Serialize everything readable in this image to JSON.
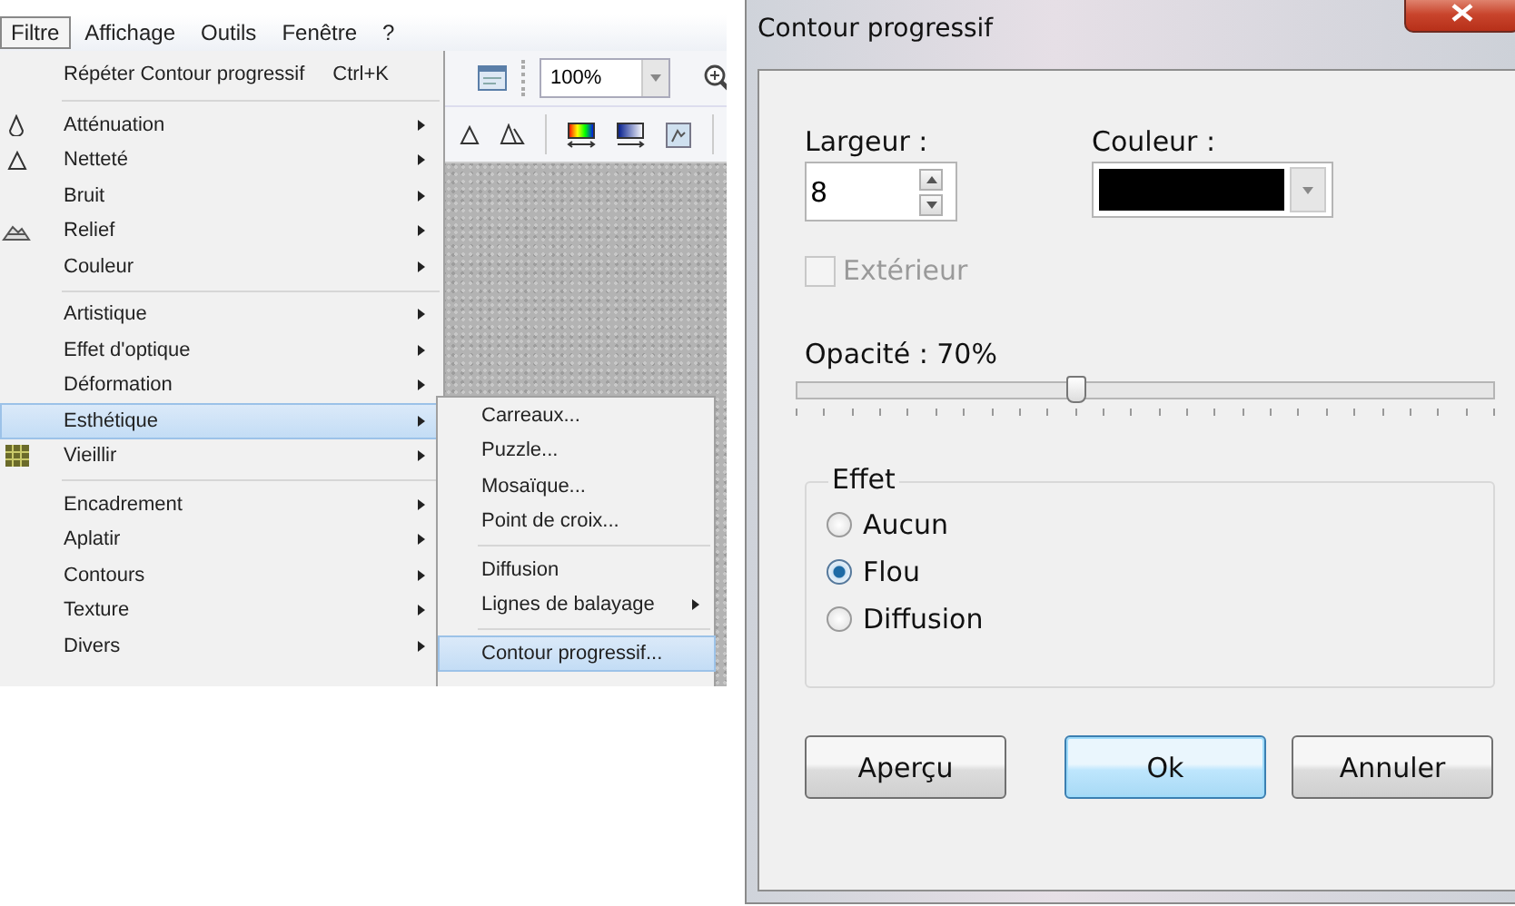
{
  "menubar": [
    {
      "label": "Filtre",
      "selected": true
    },
    {
      "label": "Affichage",
      "selected": false
    },
    {
      "label": "Outils",
      "selected": false
    },
    {
      "label": "Fenêtre",
      "selected": false
    },
    {
      "label": "?",
      "selected": false
    }
  ],
  "toolbar": {
    "zoom": "100%"
  },
  "filter_menu": {
    "groups": [
      [
        {
          "label": "Répéter Contour progressif",
          "shortcut": "Ctrl+K",
          "submenu": false,
          "selected": false,
          "kind": "plain"
        }
      ],
      [
        {
          "label": "Atténuation",
          "submenu": true,
          "selected": false,
          "kind": "drop"
        },
        {
          "label": "Netteté",
          "submenu": true,
          "selected": false,
          "kind": "triangle"
        },
        {
          "label": "Bruit",
          "submenu": true,
          "selected": false,
          "kind": "plain"
        },
        {
          "label": "Relief",
          "submenu": true,
          "selected": false,
          "kind": "mountain"
        },
        {
          "label": "Couleur",
          "submenu": true,
          "selected": false,
          "kind": "plain"
        }
      ],
      [
        {
          "label": "Artistique",
          "submenu": true,
          "selected": false,
          "kind": "plain"
        },
        {
          "label": "Effet d'optique",
          "submenu": true,
          "selected": false,
          "kind": "plain"
        },
        {
          "label": "Déformation",
          "submenu": true,
          "selected": false,
          "kind": "plain"
        },
        {
          "label": "Esthétique",
          "submenu": true,
          "selected": true,
          "kind": "plain"
        },
        {
          "label": "Vieillir",
          "submenu": true,
          "selected": false,
          "kind": "grid"
        }
      ],
      [
        {
          "label": "Encadrement",
          "submenu": true,
          "selected": false,
          "kind": "plain"
        },
        {
          "label": "Aplatir",
          "submenu": true,
          "selected": false,
          "kind": "plain"
        },
        {
          "label": "Contours",
          "submenu": true,
          "selected": false,
          "kind": "plain"
        },
        {
          "label": "Texture",
          "submenu": true,
          "selected": false,
          "kind": "plain"
        },
        {
          "label": "Divers",
          "submenu": true,
          "selected": false,
          "kind": "plain"
        }
      ]
    ]
  },
  "submenu": {
    "groups": [
      [
        {
          "label": "Carreaux...",
          "submenu": false,
          "selected": false
        },
        {
          "label": "Puzzle...",
          "submenu": false,
          "selected": false
        },
        {
          "label": "Mosaïque...",
          "submenu": false,
          "selected": false
        },
        {
          "label": "Point de croix...",
          "submenu": false,
          "selected": false
        }
      ],
      [
        {
          "label": "Diffusion",
          "submenu": false,
          "selected": false
        },
        {
          "label": "Lignes de balayage",
          "submenu": true,
          "selected": false
        }
      ],
      [
        {
          "label": "Contour progressif...",
          "submenu": false,
          "selected": true
        }
      ]
    ]
  },
  "dialog": {
    "title": "Contour progressif",
    "width": {
      "label": "Largeur :",
      "value": "8"
    },
    "color": {
      "label": "Couleur :"
    },
    "outside": {
      "label": "Extérieur",
      "checked": false,
      "disabled": true
    },
    "opacity": {
      "label": "Opacité : 70%",
      "level": 0.4
    },
    "effect": {
      "title": "Effet",
      "options": [
        {
          "label": "Aucun",
          "selected": false
        },
        {
          "label": "Flou",
          "selected": true
        },
        {
          "label": "Diffusion",
          "selected": false
        }
      ]
    },
    "buttons": [
      {
        "label": "Aperçu",
        "default": false
      },
      {
        "label": "Ok",
        "default": true
      },
      {
        "label": "Annuler",
        "default": false
      }
    ]
  }
}
